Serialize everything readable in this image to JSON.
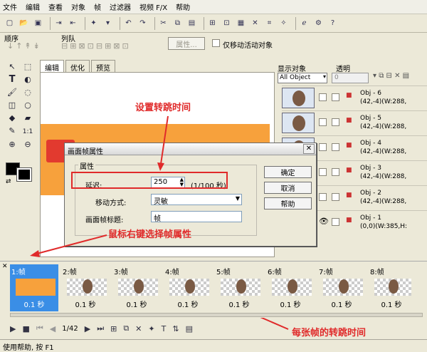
{
  "menu": [
    "文件",
    "编辑",
    "查看",
    "对象",
    "帧",
    "过滤器",
    "视频 F/X",
    "帮助"
  ],
  "orderbar": {
    "order_label": "顺序",
    "arrange_label": "列队",
    "properties_btn": "属性...",
    "only_move_active": "仅移动活动对象"
  },
  "tabs": [
    "编辑",
    "优化",
    "预览"
  ],
  "right_panel": {
    "show_objects_label": "显示对象",
    "transparency_label": "透明",
    "objects_select": "All Object",
    "transparency_value": "0",
    "objects": [
      {
        "name": "Obj - 6",
        "info": "(42,-4)(W:288,"
      },
      {
        "name": "Obj - 5",
        "info": "(42,-4)(W:288,"
      },
      {
        "name": "Obj - 4",
        "info": "(42,-4)(W:288,"
      },
      {
        "name": "Obj - 3",
        "info": "(42,-4)(W:288,"
      },
      {
        "name": "Obj - 2",
        "info": "(42,-4)(W:288,"
      },
      {
        "name": "Obj - 1",
        "info": "(0,0)(W:385,H:"
      }
    ]
  },
  "dialog": {
    "title": "画面帧属性",
    "group_label": "属性",
    "delay_label": "延迟:",
    "delay_value": "250",
    "delay_unit": "(1/100 秒)",
    "move_label": "移动方式:",
    "move_value": "灵敏",
    "frame_title_label": "画面帧标题:",
    "frame_title_value": "帧",
    "ok": "确定",
    "cancel": "取消",
    "help": "帮助"
  },
  "annotations": {
    "set_time": "设置转跳时间",
    "right_click": "鼠标右键选择帧属性",
    "each_frame": "每张帧的转跳时间"
  },
  "frames": [
    {
      "label": "1:帧",
      "delay": "0.1 秒"
    },
    {
      "label": "2:帧",
      "delay": "0.1 秒"
    },
    {
      "label": "3:帧",
      "delay": "0.1 秒"
    },
    {
      "label": "4:帧",
      "delay": "0.1 秒"
    },
    {
      "label": "5:帧",
      "delay": "0.1 秒"
    },
    {
      "label": "6:帧",
      "delay": "0.1 秒"
    },
    {
      "label": "7:帧",
      "delay": "0.1 秒"
    },
    {
      "label": "8:帧",
      "delay": "0.1 秒"
    }
  ],
  "playbar": {
    "frame_counter": "1/42"
  },
  "status": {
    "text": "使用帮助, 按 F1"
  },
  "colors": {
    "accent_red": "#e02a2a",
    "selected_frame": "#3a8ee6",
    "canvas_orange": "#f7a13c"
  }
}
